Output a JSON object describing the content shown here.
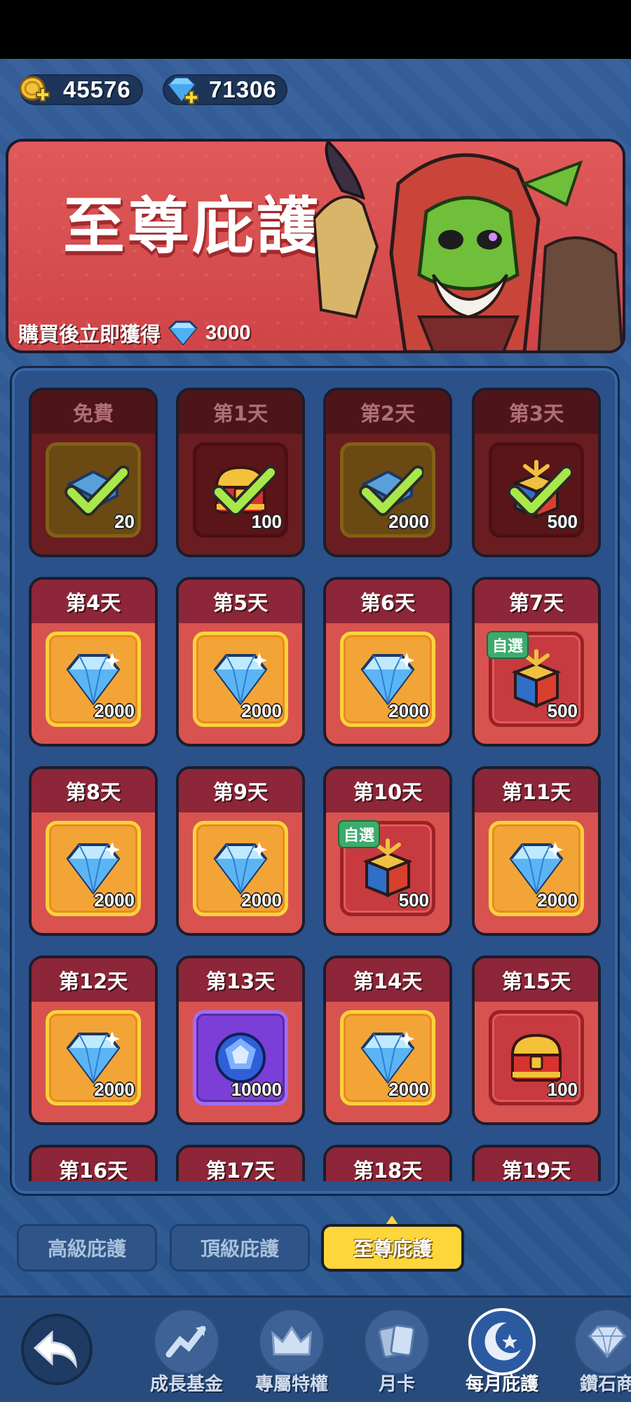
{
  "currencies": {
    "coins": "45576",
    "gems": "71306"
  },
  "banner": {
    "title": "至尊庇護",
    "subtitle": "購買後立即獲得",
    "bonus_amount": "3000"
  },
  "cards": [
    {
      "label": "免費",
      "qty": "20",
      "item": "gem-stack",
      "slot": "gold",
      "claimed": true
    },
    {
      "label": "第1天",
      "qty": "100",
      "item": "chest",
      "slot": "red",
      "claimed": true
    },
    {
      "label": "第2天",
      "qty": "2000",
      "item": "gem-stack",
      "slot": "gold",
      "claimed": true
    },
    {
      "label": "第3天",
      "qty": "500",
      "item": "box",
      "slot": "red",
      "claimed": true
    },
    {
      "label": "第4天",
      "qty": "2000",
      "item": "diamond",
      "slot": "gold",
      "claimed": false
    },
    {
      "label": "第5天",
      "qty": "2000",
      "item": "diamond",
      "slot": "gold",
      "claimed": false
    },
    {
      "label": "第6天",
      "qty": "2000",
      "item": "diamond",
      "slot": "gold",
      "claimed": false
    },
    {
      "label": "第7天",
      "qty": "500",
      "item": "box",
      "slot": "red",
      "claimed": false,
      "badge": "自選"
    },
    {
      "label": "第8天",
      "qty": "2000",
      "item": "diamond",
      "slot": "gold",
      "claimed": false
    },
    {
      "label": "第9天",
      "qty": "2000",
      "item": "diamond",
      "slot": "gold",
      "claimed": false
    },
    {
      "label": "第10天",
      "qty": "500",
      "item": "box",
      "slot": "red",
      "claimed": false,
      "badge": "自選"
    },
    {
      "label": "第11天",
      "qty": "2000",
      "item": "diamond",
      "slot": "gold",
      "claimed": false
    },
    {
      "label": "第12天",
      "qty": "2000",
      "item": "diamond",
      "slot": "gold",
      "claimed": false
    },
    {
      "label": "第13天",
      "qty": "10000",
      "item": "sapphire",
      "slot": "purple",
      "claimed": false
    },
    {
      "label": "第14天",
      "qty": "2000",
      "item": "diamond",
      "slot": "gold",
      "claimed": false
    },
    {
      "label": "第15天",
      "qty": "100",
      "item": "chest",
      "slot": "red",
      "claimed": false
    },
    {
      "label": "第16天"
    },
    {
      "label": "第17天"
    },
    {
      "label": "第18天"
    },
    {
      "label": "第19天"
    }
  ],
  "tabs": [
    {
      "label": "高級庇護",
      "active": false
    },
    {
      "label": "頂級庇護",
      "active": false
    },
    {
      "label": "至尊庇護",
      "active": true
    }
  ],
  "nav": [
    {
      "label": "成長基金",
      "icon": "growth-chart-icon",
      "active": false
    },
    {
      "label": "專屬特權",
      "icon": "crown-icon",
      "active": false
    },
    {
      "label": "月卡",
      "icon": "cards-icon",
      "active": false
    },
    {
      "label": "每月庇護",
      "icon": "moon-icon",
      "active": true
    },
    {
      "label": "鑽石商",
      "icon": "diamond-icon",
      "active": false
    }
  ]
}
